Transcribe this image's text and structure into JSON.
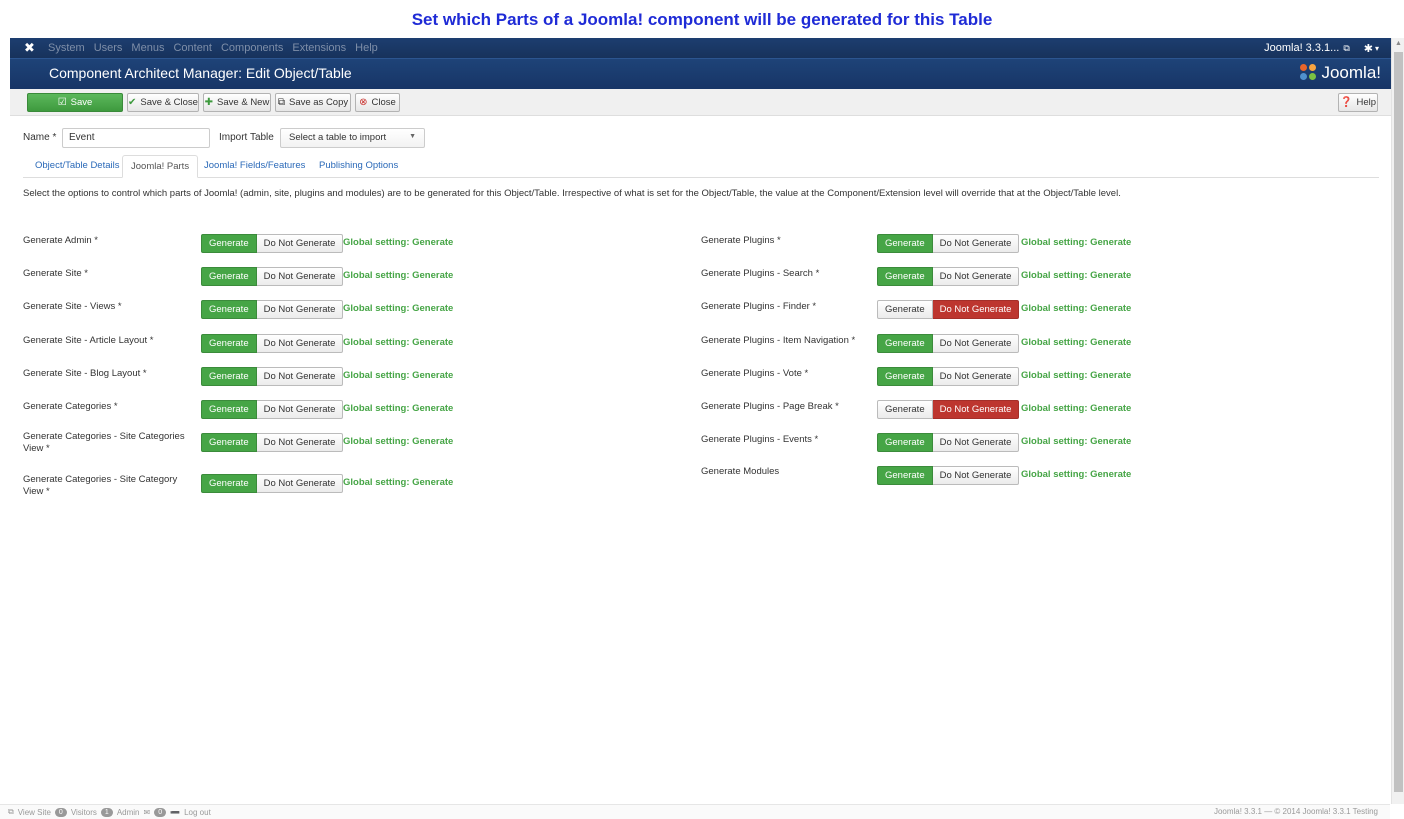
{
  "caption": "Set which Parts of a Joomla! component will be generated for this Table",
  "topbar": {
    "menu": [
      "System",
      "Users",
      "Menus",
      "Content",
      "Components",
      "Extensions",
      "Help"
    ],
    "site_label": "Joomla! 3.3.1..."
  },
  "header": {
    "title": "Component Architect Manager: Edit Object/Table",
    "brand": "Joomla!"
  },
  "toolbar": {
    "save": "Save",
    "save_close": "Save & Close",
    "save_new": "Save & New",
    "save_copy": "Save as Copy",
    "close": "Close",
    "help": "Help"
  },
  "form": {
    "name_label": "Name *",
    "name_value": "Event",
    "import_label": "Import Table",
    "import_placeholder": "Select a table to import"
  },
  "tabs": [
    "Object/Table Details",
    "Joomla! Parts",
    "Joomla! Fields/Features",
    "Publishing Options"
  ],
  "description": "Select the options to control which parts of Joomla! (admin, site, plugins and modules) are to be generated for this Object/Table. Irrespective of what is set for the Object/Table, the value at the Component/Extension level will override that at the Object/Table level.",
  "buttons": {
    "generate": "Generate",
    "do_not_generate": "Do Not Generate"
  },
  "global_text": "Global setting: Generate",
  "left_options": [
    {
      "label": "Generate Admin *",
      "selected": "generate"
    },
    {
      "label": "Generate Site *",
      "selected": "generate"
    },
    {
      "label": "Generate Site - Views *",
      "selected": "generate"
    },
    {
      "label": "Generate Site - Article Layout *",
      "selected": "generate"
    },
    {
      "label": "Generate Site - Blog Layout *",
      "selected": "generate"
    },
    {
      "label": "Generate Categories *",
      "selected": "generate"
    },
    {
      "label": "Generate Categories - Site Categories View *",
      "selected": "generate"
    },
    {
      "label": "Generate Categories - Site Category View *",
      "selected": "generate"
    }
  ],
  "right_options": [
    {
      "label": "Generate Plugins *",
      "selected": "generate"
    },
    {
      "label": "Generate Plugins - Search *",
      "selected": "generate"
    },
    {
      "label": "Generate Plugins - Finder *",
      "selected": "do_not_generate"
    },
    {
      "label": "Generate Plugins - Item Navigation *",
      "selected": "generate"
    },
    {
      "label": "Generate Plugins - Vote *",
      "selected": "generate"
    },
    {
      "label": "Generate Plugins - Page Break *",
      "selected": "do_not_generate"
    },
    {
      "label": "Generate Plugins - Events *",
      "selected": "generate"
    },
    {
      "label": "Generate Modules",
      "selected": "generate"
    }
  ],
  "status": {
    "view_site": "View Site",
    "visitors_count": "0",
    "visitors": "Visitors",
    "admin_count": "1",
    "admin": "Admin",
    "messages_count": "0",
    "logout": "Log out",
    "footer": "Joomla! 3.3.1 — © 2014 Joomla! 3.3.1 Testing"
  }
}
